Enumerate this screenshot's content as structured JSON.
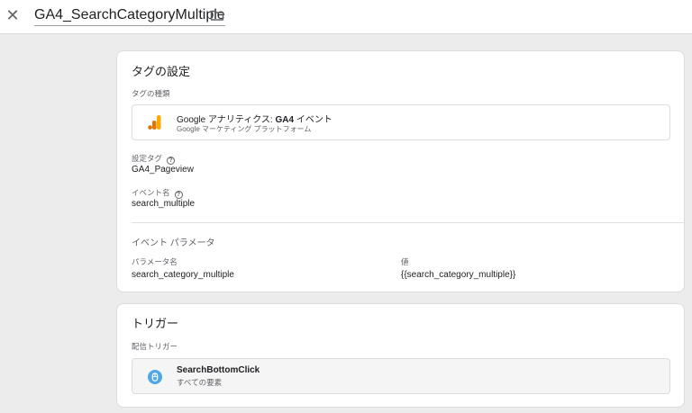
{
  "header": {
    "title": "GA4_SearchCategoryMultiple",
    "close_icon": "close-icon",
    "folder_icon": "folder-icon"
  },
  "tag_config": {
    "title": "タグの設定",
    "type_label": "タグの種類",
    "tag_type": {
      "name_prefix": "Google アナリティクス: ",
      "name_bold": "GA4",
      "name_suffix": " イベント",
      "subtitle": "Google マーケティング プラットフォーム",
      "icon": "google-analytics-icon"
    },
    "config_tag_label": "設定タグ",
    "config_tag_value": "GA4_Pageview",
    "event_name_label": "イベント名",
    "event_name_value": "search_multiple",
    "help_glyph": "?",
    "params_title": "イベント パラメータ",
    "params_headers": {
      "name": "パラメータ名",
      "value": "値"
    },
    "params": [
      {
        "name": "search_category_multiple",
        "value": "{{search_category_multiple}}"
      }
    ]
  },
  "trigger": {
    "title": "トリガー",
    "firing_label": "配信トリガー",
    "items": [
      {
        "name": "SearchBottomClick",
        "subtitle": "すべての要素",
        "icon": "click-trigger-icon"
      }
    ]
  },
  "colors": {
    "ga_orange": "#f9ab00",
    "ga_dark_orange": "#e37400",
    "trigger_blue": "#4fa8e5"
  }
}
